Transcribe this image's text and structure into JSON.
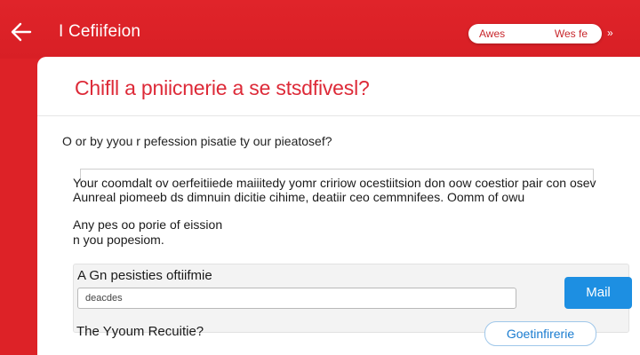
{
  "header": {
    "title": "I Cefiifeion",
    "pill": {
      "left_text": "Awes",
      "right_text": "Wes fe"
    },
    "pill_arrow": "»",
    "background_color": "#dd2227"
  },
  "card": {
    "title": "Chifll a pniicnerie a se stsdfivesl?",
    "question": "O or by yyou r pefession pisatie ty our pieatosef?",
    "paragraph": "Your coomdalt ov oerfeitiiede maiiitedy yomr cririow ocestiitsion don oow coestior pair con osev Aunreal piomeeb ds dimnuin dicitie cihime, deatiir ceo cemmnifees. Oomm of owu",
    "sub_text_line1": "Any pes oo porie of eission",
    "sub_text_line2": "n you popesiom.",
    "panel": {
      "label": "A Gn pesisties oftiifmie",
      "input_value": "deacdes",
      "button_label": "Mail",
      "button_color": "#1d8fe2"
    },
    "footer": {
      "text": "The Yyoum Recuitie?",
      "button_label": "Goetinfirerie"
    },
    "title_color": "#dd2a38"
  },
  "icons": {
    "back": "arrow-left-icon"
  }
}
